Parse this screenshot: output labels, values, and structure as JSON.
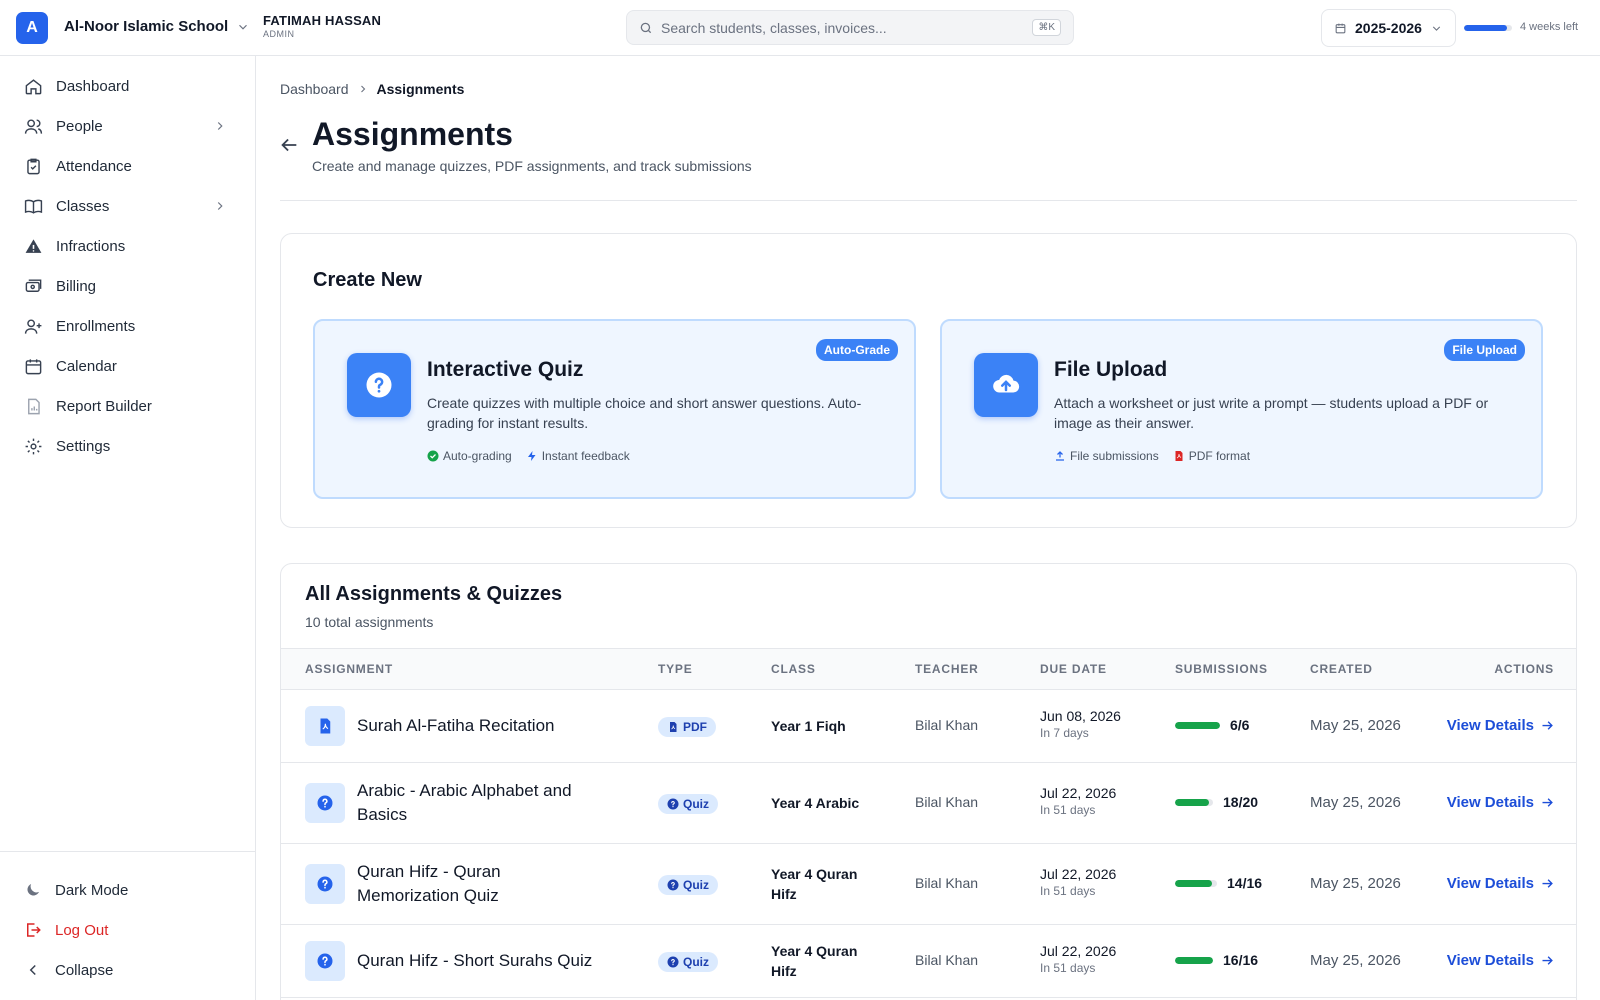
{
  "header": {
    "logo_letter": "A",
    "school_name": "Al-Noor Islamic School",
    "user_name": "FATIMAH HASSAN",
    "user_role": "ADMIN",
    "search_placeholder": "Search students, classes, invoices...",
    "search_shortcut": "⌘K",
    "academic_year": "2025-2026",
    "term_progress_fraction": 0.9,
    "term_remaining": "4 weeks left"
  },
  "sidebar": {
    "items": [
      {
        "label": "Dashboard",
        "icon": "home-icon"
      },
      {
        "label": "People",
        "icon": "users-icon",
        "has_submenu": true
      },
      {
        "label": "Attendance",
        "icon": "clipboard-check-icon"
      },
      {
        "label": "Classes",
        "icon": "book-icon",
        "has_submenu": true
      },
      {
        "label": "Infractions",
        "icon": "warning-icon"
      },
      {
        "label": "Billing",
        "icon": "billing-icon"
      },
      {
        "label": "Enrollments",
        "icon": "user-plus-icon"
      },
      {
        "label": "Calendar",
        "icon": "calendar-icon"
      },
      {
        "label": "Report Builder",
        "icon": "report-icon"
      },
      {
        "label": "Settings",
        "icon": "gear-icon"
      }
    ],
    "footer": {
      "dark_mode": "Dark Mode",
      "logout": "Log Out",
      "collapse": "Collapse"
    }
  },
  "breadcrumb": {
    "root": "Dashboard",
    "current": "Assignments"
  },
  "page": {
    "title": "Assignments",
    "subtitle": "Create and manage quizzes, PDF assignments, and track submissions"
  },
  "create_new": {
    "title": "Create New",
    "options": [
      {
        "title": "Interactive Quiz",
        "description": "Create quizzes with multiple choice and short answer questions. Auto-grading for instant results.",
        "badge": "Auto-Grade",
        "features": [
          "Auto-grading",
          "Instant feedback"
        ]
      },
      {
        "title": "File Upload",
        "description": "Attach a worksheet or just write a prompt — students upload a PDF or image as their answer.",
        "badge": "File Upload",
        "features": [
          "File submissions",
          "PDF format"
        ]
      }
    ]
  },
  "assignments": {
    "title": "All Assignments & Quizzes",
    "count_label": "10 total assignments",
    "columns": [
      "ASSIGNMENT",
      "TYPE",
      "CLASS",
      "TEACHER",
      "DUE DATE",
      "SUBMISSIONS",
      "CREATED",
      "ACTIONS"
    ],
    "action_label": "View Details",
    "rows": [
      {
        "name": "Surah Al-Fatiha Recitation",
        "type": "PDF",
        "class": "Year 1 Fiqh",
        "teacher": "Bilal Khan",
        "due_date": "Jun 08, 2026",
        "due_relative": "In 7 days",
        "submissions": "6/6",
        "submitted_fraction": 1.0,
        "created": "May 25, 2026"
      },
      {
        "name": "Arabic - Arabic Alphabet and Basics",
        "type": "Quiz",
        "class": "Year 4 Arabic",
        "teacher": "Bilal Khan",
        "due_date": "Jul 22, 2026",
        "due_relative": "In 51 days",
        "submissions": "18/20",
        "submitted_fraction": 0.9,
        "created": "May 25, 2026"
      },
      {
        "name": "Quran Hifz - Quran Memorization Quiz",
        "type": "Quiz",
        "class": "Year 4 Quran Hifz",
        "teacher": "Bilal Khan",
        "due_date": "Jul 22, 2026",
        "due_relative": "In 51 days",
        "submissions": "14/16",
        "submitted_fraction": 0.875,
        "created": "May 25, 2026"
      },
      {
        "name": "Quran Hifz - Short Surahs Quiz",
        "type": "Quiz",
        "class": "Year 4 Quran Hifz",
        "teacher": "Bilal Khan",
        "due_date": "Jul 22, 2026",
        "due_relative": "In 51 days",
        "submissions": "16/16",
        "submitted_fraction": 1.0,
        "created": "May 25, 2026"
      }
    ]
  },
  "colors": {
    "primary": "#2563eb",
    "success": "#16a34a",
    "danger": "#dc2626"
  }
}
